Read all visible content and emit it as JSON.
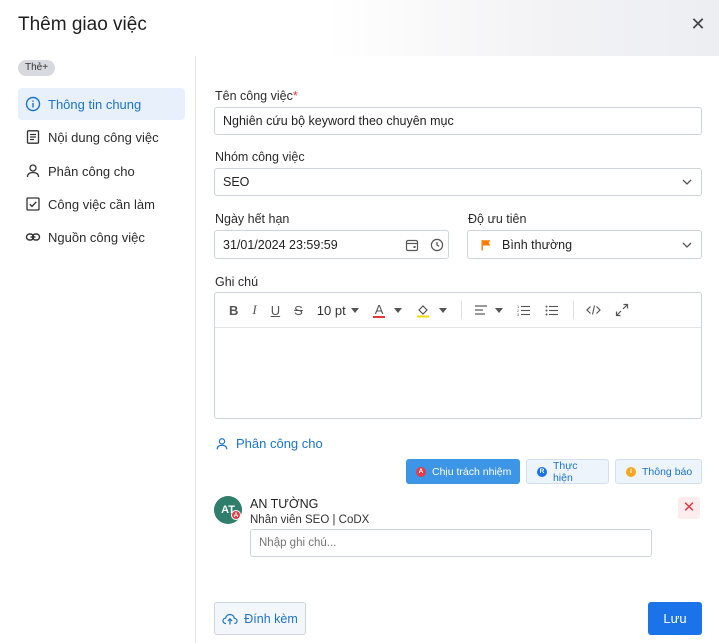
{
  "dialog": {
    "title": "Thêm giao việc",
    "tag_chip": "Thẻ+"
  },
  "sidebar": {
    "items": [
      {
        "label": "Thông tin chung",
        "icon": "info-icon",
        "active": true
      },
      {
        "label": "Nội dung công việc",
        "icon": "document-icon"
      },
      {
        "label": "Phân công cho",
        "icon": "person-icon"
      },
      {
        "label": "Công việc cần làm",
        "icon": "checkbox-icon"
      },
      {
        "label": "Nguồn công việc",
        "icon": "link-icon"
      }
    ]
  },
  "form": {
    "task_name": {
      "label": "Tên công việc",
      "required_mark": "*",
      "value": "Nghiên cứu bộ keyword theo chuyên mục"
    },
    "task_group": {
      "label": "Nhóm công việc",
      "value": "SEO"
    },
    "due_date": {
      "label": "Ngày hết hạn",
      "value": "31/01/2024 23:59:59"
    },
    "priority": {
      "label": "Độ ưu tiên",
      "value": "Bình thường",
      "flag_color": "#f57c00"
    },
    "note": {
      "label": "Ghi chú",
      "toolbar": {
        "bold": "B",
        "italic": "I",
        "underline": "U",
        "strike": "S",
        "font_size": "10 pt",
        "font_color": "A"
      }
    }
  },
  "assignment": {
    "title": "Phân công cho",
    "roles": [
      {
        "label": "Chịu trách nhiệm",
        "badge": "A",
        "badge_color": "#e53b47",
        "active": true
      },
      {
        "label": "Thực hiện",
        "badge": "R",
        "badge_color": "#1a73e8"
      },
      {
        "label": "Thông báo",
        "badge": "I",
        "badge_color": "#f5a623"
      }
    ],
    "assignee": {
      "initials": "AT",
      "badge": "A",
      "name": "AN TƯỜNG",
      "position": "Nhân viên SEO | CoDX",
      "note_placeholder": "Nhập ghi chú..."
    }
  },
  "footer": {
    "attach_label": "Đính kèm",
    "save_label": "Lưu"
  },
  "colors": {
    "accent": "#1a73e8",
    "active_bg": "#e8f1fb",
    "danger": "#e53b47"
  }
}
